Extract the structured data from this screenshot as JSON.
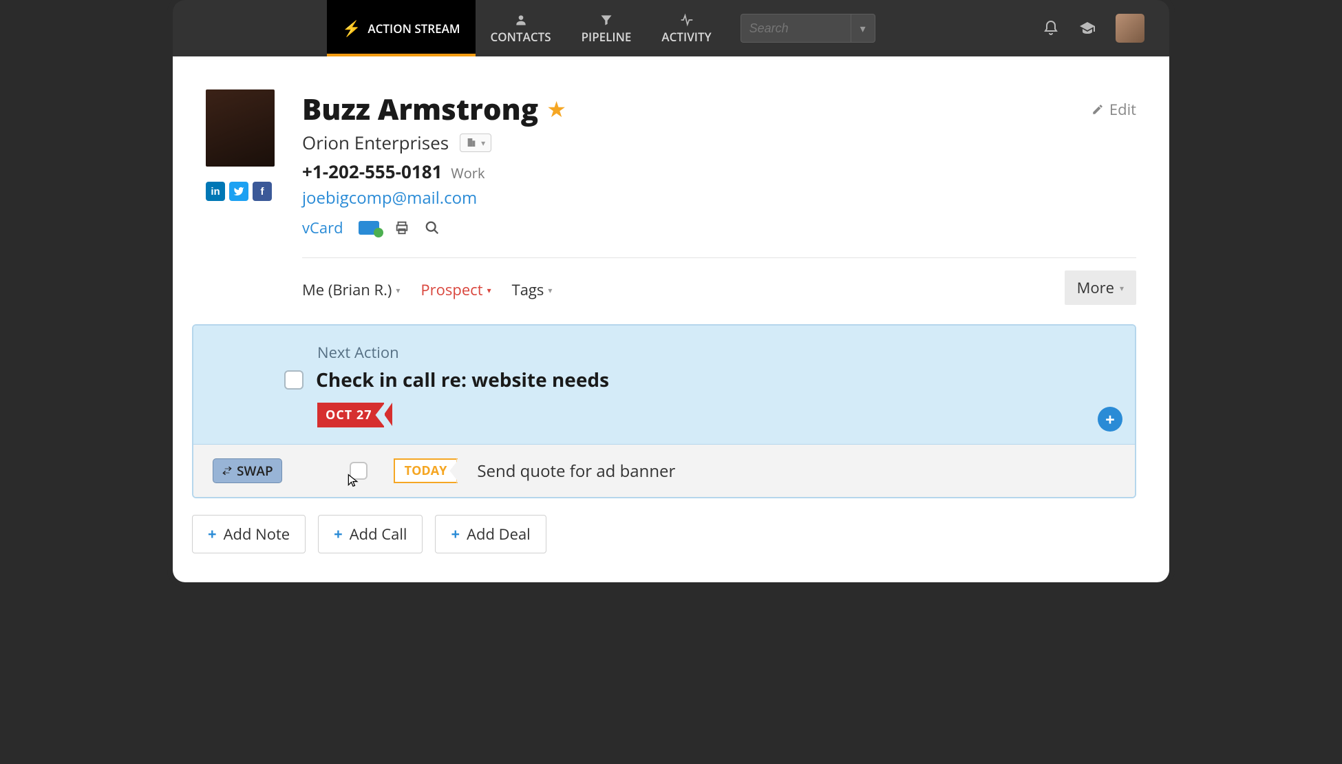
{
  "nav": {
    "action_stream": "ACTION STREAM",
    "contacts": "CONTACTS",
    "pipeline": "PIPELINE",
    "activity": "ACTIVITY"
  },
  "search": {
    "placeholder": "Search"
  },
  "contact": {
    "name": "Buzz Armstrong",
    "company": "Orion Enterprises",
    "phone": "+1-202-555-0181",
    "phone_type": "Work",
    "email": "joebigcomp@mail.com",
    "vcard": "vCard",
    "edit": "Edit"
  },
  "filters": {
    "owner": "Me (Brian R.)",
    "status": "Prospect",
    "tags": "Tags",
    "more": "More"
  },
  "next_action": {
    "label": "Next Action",
    "title": "Check in call re: website needs",
    "date": "OCT 27"
  },
  "secondary_action": {
    "swap": "SWAP",
    "date": "TODAY",
    "title": "Send quote for ad banner"
  },
  "buttons": {
    "add_note": "Add Note",
    "add_call": "Add Call",
    "add_deal": "Add Deal"
  }
}
